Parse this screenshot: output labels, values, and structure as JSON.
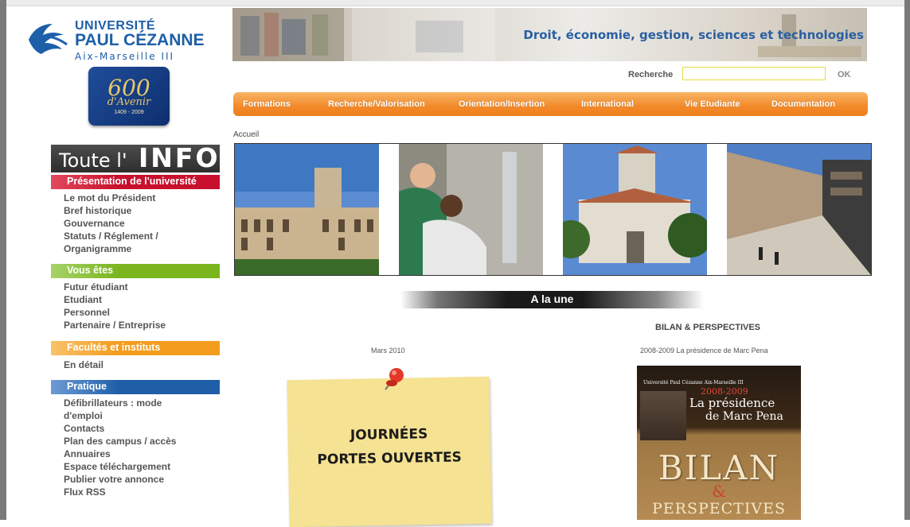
{
  "logo": {
    "line1": "UNIVERSITÉ",
    "line2": "PAUL CÉZANNE",
    "line3": "Aix-Marseille III"
  },
  "anniversary": {
    "number": "600",
    "word": "d'Avenir",
    "dates": "1409 - 2009"
  },
  "banner": {
    "tagline": "Droit, économie, gestion, sciences et technologies"
  },
  "search": {
    "label": "Recherche",
    "value": "",
    "ok": "OK"
  },
  "nav": [
    "Formations",
    "Recherche/Valorisation",
    "Orientation/Insertion",
    "International",
    "Vie Etudiante",
    "Documentation"
  ],
  "breadcrumb": "Accueil",
  "sidebar": {
    "toute": "Toute l'",
    "info": "INFO",
    "sections": [
      {
        "title": "Présentation de l'université",
        "color": "#c8102e",
        "links": [
          "Le mot du Président",
          "Bref historique",
          "Gouvernance",
          "Statuts / Réglement /",
          "Organigramme"
        ]
      },
      {
        "title": "Vous êtes",
        "color": "#7ab51d",
        "links": [
          "Futur étudiant",
          "Etudiant",
          "Personnel",
          "Partenaire / Entreprise"
        ]
      },
      {
        "title": "Facultés et instituts",
        "color": "#f39c1e",
        "links": [
          "En détail"
        ]
      },
      {
        "title": "Pratique",
        "color": "#1f5fa8",
        "links": [
          "Défibrillateurs : mode",
          "d'emploi",
          "Contacts",
          "Plan des campus / accès",
          "Annuaires",
          "Espace téléchargement",
          "Publier votre annonce",
          "Flux RSS"
        ]
      }
    ]
  },
  "headline": "A la une",
  "news_left": {
    "date": "Mars 2010",
    "postit_line1": "JOURNÉES",
    "postit_line2": "PORTES OUVERTES"
  },
  "news_right": {
    "title": "BILAN & PERSPECTIVES",
    "subtitle": "2008-2009 La présidence de Marc Pena",
    "cover_top": "Université Paul Cézanne Aix-Marseille III",
    "cover_years": "2008-2009",
    "cover_line1": "La présidence",
    "cover_line2": "de Marc Pena",
    "cover_big1": "BILAN",
    "cover_big2": "&",
    "cover_big3": "PERSPECTIVES"
  }
}
